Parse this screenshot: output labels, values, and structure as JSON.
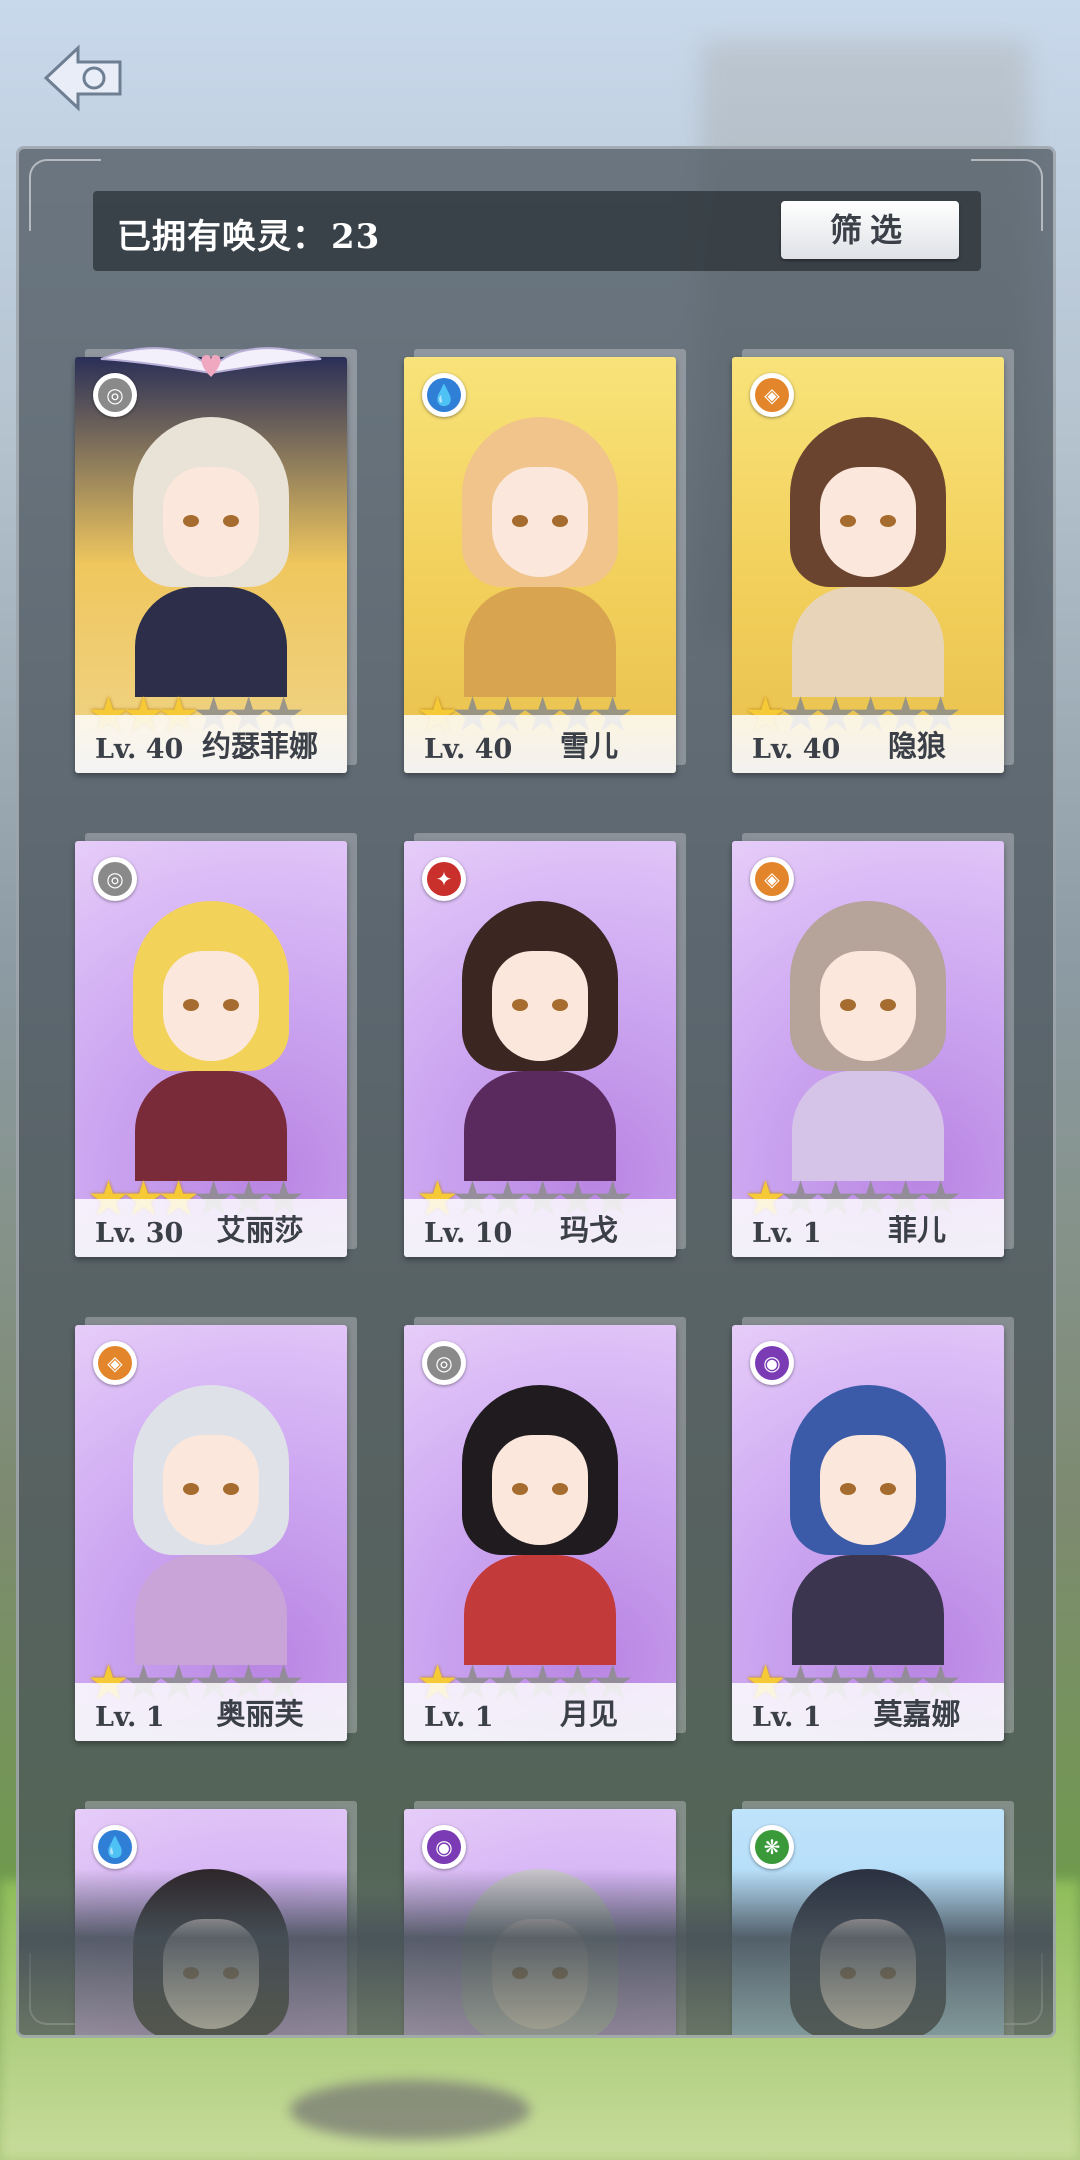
{
  "header": {
    "owned_label": "已拥有唤灵：",
    "owned_count": "23",
    "filter_label": "筛选"
  },
  "colors": {
    "star_on": "#f6c936",
    "star_off": "#8c8c8c"
  },
  "cards": [
    {
      "level": "Lv. 40",
      "name": "约瑟菲娜",
      "stars": 3,
      "max_stars": 6,
      "element": "neutral-icon",
      "rarity": "special"
    },
    {
      "level": "Lv. 40",
      "name": "雪儿",
      "stars": 1,
      "max_stars": 6,
      "element": "water-icon",
      "rarity": "gold"
    },
    {
      "level": "Lv. 40",
      "name": "隐狼",
      "stars": 1,
      "max_stars": 6,
      "element": "earth-icon",
      "rarity": "gold"
    },
    {
      "level": "Lv. 30",
      "name": "艾丽莎",
      "stars": 3,
      "max_stars": 6,
      "element": "neutral-icon",
      "rarity": "purple"
    },
    {
      "level": "Lv. 10",
      "name": "玛戈",
      "stars": 1,
      "max_stars": 6,
      "element": "fire-icon",
      "rarity": "purple"
    },
    {
      "level": "Lv. 1",
      "name": "菲儿",
      "stars": 1,
      "max_stars": 6,
      "element": "earth-icon",
      "rarity": "purple"
    },
    {
      "level": "Lv. 1",
      "name": "奥丽芙",
      "stars": 1,
      "max_stars": 6,
      "element": "earth-icon",
      "rarity": "purple"
    },
    {
      "level": "Lv. 1",
      "name": "月见",
      "stars": 1,
      "max_stars": 6,
      "element": "neutral-icon",
      "rarity": "purple"
    },
    {
      "level": "Lv. 1",
      "name": "莫嘉娜",
      "stars": 1,
      "max_stars": 6,
      "element": "dark-icon",
      "rarity": "purple"
    },
    {
      "level": "",
      "name": "",
      "stars": 0,
      "max_stars": 0,
      "element": "water-icon",
      "rarity": "purple"
    },
    {
      "level": "",
      "name": "",
      "stars": 0,
      "max_stars": 0,
      "element": "dark-icon",
      "rarity": "purple"
    },
    {
      "level": "",
      "name": "",
      "stars": 0,
      "max_stars": 0,
      "element": "wind-icon",
      "rarity": "blue"
    }
  ]
}
